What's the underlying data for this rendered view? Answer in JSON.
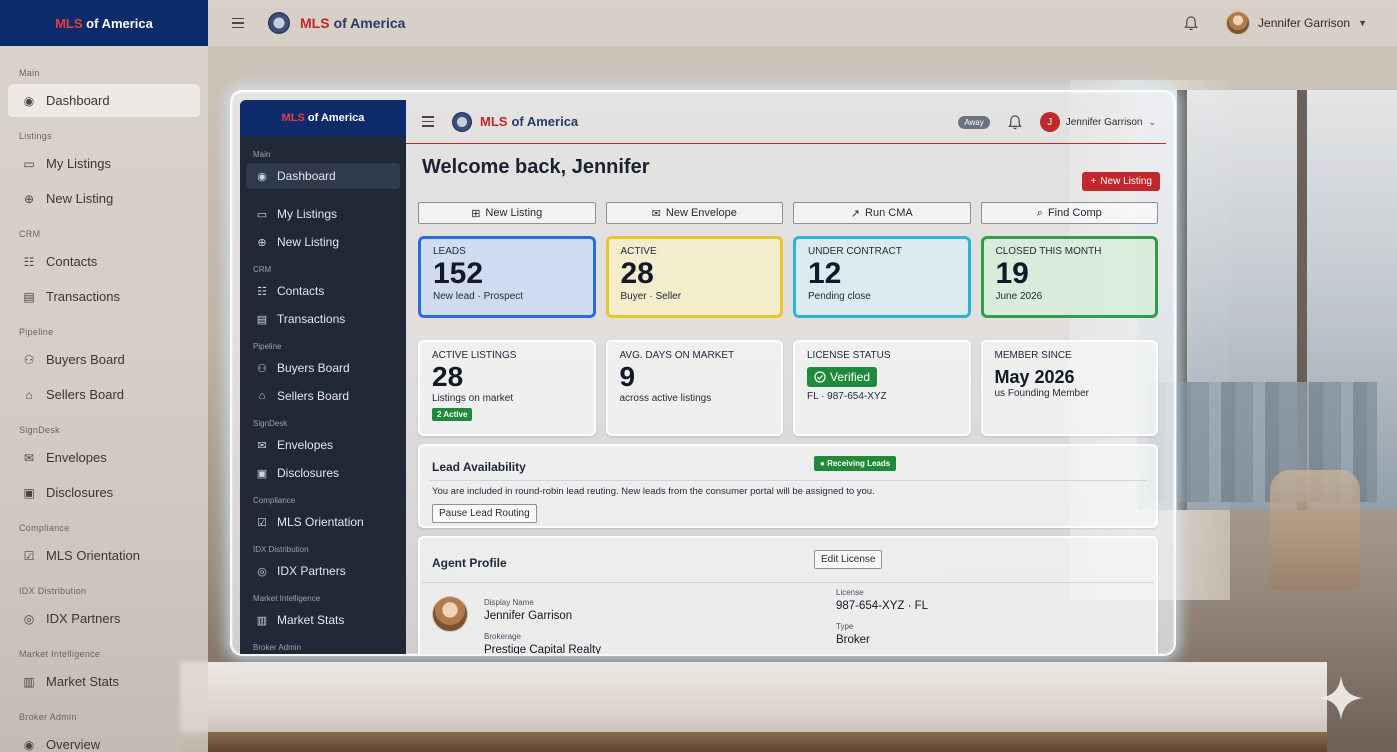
{
  "brand": {
    "mls": "MLS",
    "rest": "of America"
  },
  "outer": {
    "sidebar": {
      "sections": [
        {
          "label": "Main",
          "items": [
            {
              "label": "Dashboard",
              "icon": "dashboard-icon",
              "active": true
            }
          ]
        },
        {
          "label": "Listings",
          "items": [
            {
              "label": "My Listings",
              "icon": "listings-icon"
            },
            {
              "label": "New Listing",
              "icon": "plus-circle-icon"
            }
          ]
        },
        {
          "label": "CRM",
          "items": [
            {
              "label": "Contacts",
              "icon": "contacts-icon"
            },
            {
              "label": "Transactions",
              "icon": "transactions-icon"
            }
          ]
        },
        {
          "label": "Pipeline",
          "items": [
            {
              "label": "Buyers Board",
              "icon": "buyers-icon"
            },
            {
              "label": "Sellers Board",
              "icon": "home-icon"
            }
          ]
        },
        {
          "label": "SignDesk",
          "items": [
            {
              "label": "Envelopes",
              "icon": "envelope-icon"
            },
            {
              "label": "Disclosures",
              "icon": "document-icon"
            }
          ]
        },
        {
          "label": "Compliance",
          "items": [
            {
              "label": "MLS Orientation",
              "icon": "checkbox-icon"
            }
          ]
        },
        {
          "label": "IDX Distribution",
          "items": [
            {
              "label": "IDX Partners",
              "icon": "broadcast-icon"
            }
          ]
        },
        {
          "label": "Market Intelligence",
          "items": [
            {
              "label": "Market Stats",
              "icon": "bar-chart-icon"
            }
          ]
        },
        {
          "label": "Broker Admin",
          "items": [
            {
              "label": "Overview",
              "icon": "dashboard-icon"
            }
          ]
        }
      ]
    },
    "user": {
      "name": "Jennifer Garrison"
    }
  },
  "inner": {
    "sidebar": {
      "sections": [
        {
          "label": "Main",
          "items": [
            {
              "label": "Dashboard",
              "icon": "dashboard-icon",
              "active": true
            }
          ]
        },
        {
          "label": "",
          "items": [
            {
              "label": "My Listings",
              "icon": "listings-icon"
            },
            {
              "label": "New Listing",
              "icon": "plus-circle-icon"
            }
          ]
        },
        {
          "label": "CRM",
          "items": [
            {
              "label": "Contacts",
              "icon": "contacts-icon"
            },
            {
              "label": "Transactions",
              "icon": "transactions-icon"
            }
          ]
        },
        {
          "label": "Pipeline",
          "items": [
            {
              "label": "Buyers Board",
              "icon": "buyers-icon"
            },
            {
              "label": "Sellers Board",
              "icon": "home-icon"
            }
          ]
        },
        {
          "label": "SignDesk",
          "items": [
            {
              "label": "Envelopes",
              "icon": "envelope-icon"
            },
            {
              "label": "Disclosures",
              "icon": "document-icon"
            }
          ]
        },
        {
          "label": "Compliance",
          "items": [
            {
              "label": "MLS Orientation",
              "icon": "checkbox-icon"
            }
          ]
        },
        {
          "label": "IDX Distribution",
          "items": [
            {
              "label": "IDX Partners",
              "icon": "broadcast-icon"
            }
          ]
        },
        {
          "label": "Market Intelligence",
          "items": [
            {
              "label": "Market Stats",
              "icon": "bar-chart-icon"
            }
          ]
        },
        {
          "label": "Broker Admin",
          "items": []
        }
      ]
    },
    "topbar": {
      "away": "Away",
      "user_initial": "J",
      "user_name": "Jennifer Garrison"
    },
    "welcome": "Welcome back, Jennifer",
    "new_listing_cta": "New Listing",
    "actions": [
      {
        "label": "New Listing",
        "icon": "plus-square-icon"
      },
      {
        "label": "New Envelope",
        "icon": "envelope-icon"
      },
      {
        "label": "Run CMA",
        "icon": "trend-chart-icon"
      },
      {
        "label": "Find Comp",
        "icon": "search-icon"
      }
    ],
    "stats": [
      {
        "label": "LEADS",
        "value": "152",
        "sub": "New lead · Prospect",
        "color": "#2b6be0"
      },
      {
        "label": "ACTIVE",
        "value": "28",
        "sub": "Buyer · Seller",
        "color": "#e8c52a"
      },
      {
        "label": "UNDER CONTRACT",
        "value": "12",
        "sub": "Pending close",
        "color": "#29b6d6"
      },
      {
        "label": "CLOSED THIS MONTH",
        "value": "19",
        "sub": "June 2026",
        "color": "#2f9e44"
      }
    ],
    "cards": {
      "active_listings": {
        "label": "ACTIVE LISTINGS",
        "value": "28",
        "sub": "Listings on market",
        "badge": "2 Active"
      },
      "avg_days": {
        "label": "AVG. DAYS ON MARKET",
        "value": "9",
        "sub": "across active listings"
      },
      "license": {
        "label": "LICENSE STATUS",
        "status": "Verified",
        "sub": "FL · 987-654-XYZ"
      },
      "member": {
        "label": "MEMBER SINCE",
        "value": "May 2026",
        "sub": "us Founding Member"
      }
    },
    "lead_availability": {
      "title": "Lead Availability",
      "status": "Receiving Leads",
      "text": "You are included in round-robin lead reuting. New leads from the consumer portal will be assigned to you.",
      "button": "Pause Lead Routing"
    },
    "profile": {
      "title": "Agent Profile",
      "edit_button": "Edit License",
      "display_name_label": "Display Name",
      "display_name": "Jennifer Garrison",
      "brokerage_label": "Brokerage",
      "brokerage": "Prestige Capital Realty",
      "license_label": "License",
      "license": "987-654-XYZ · FL",
      "type_label": "Type",
      "type": "Broker"
    }
  }
}
